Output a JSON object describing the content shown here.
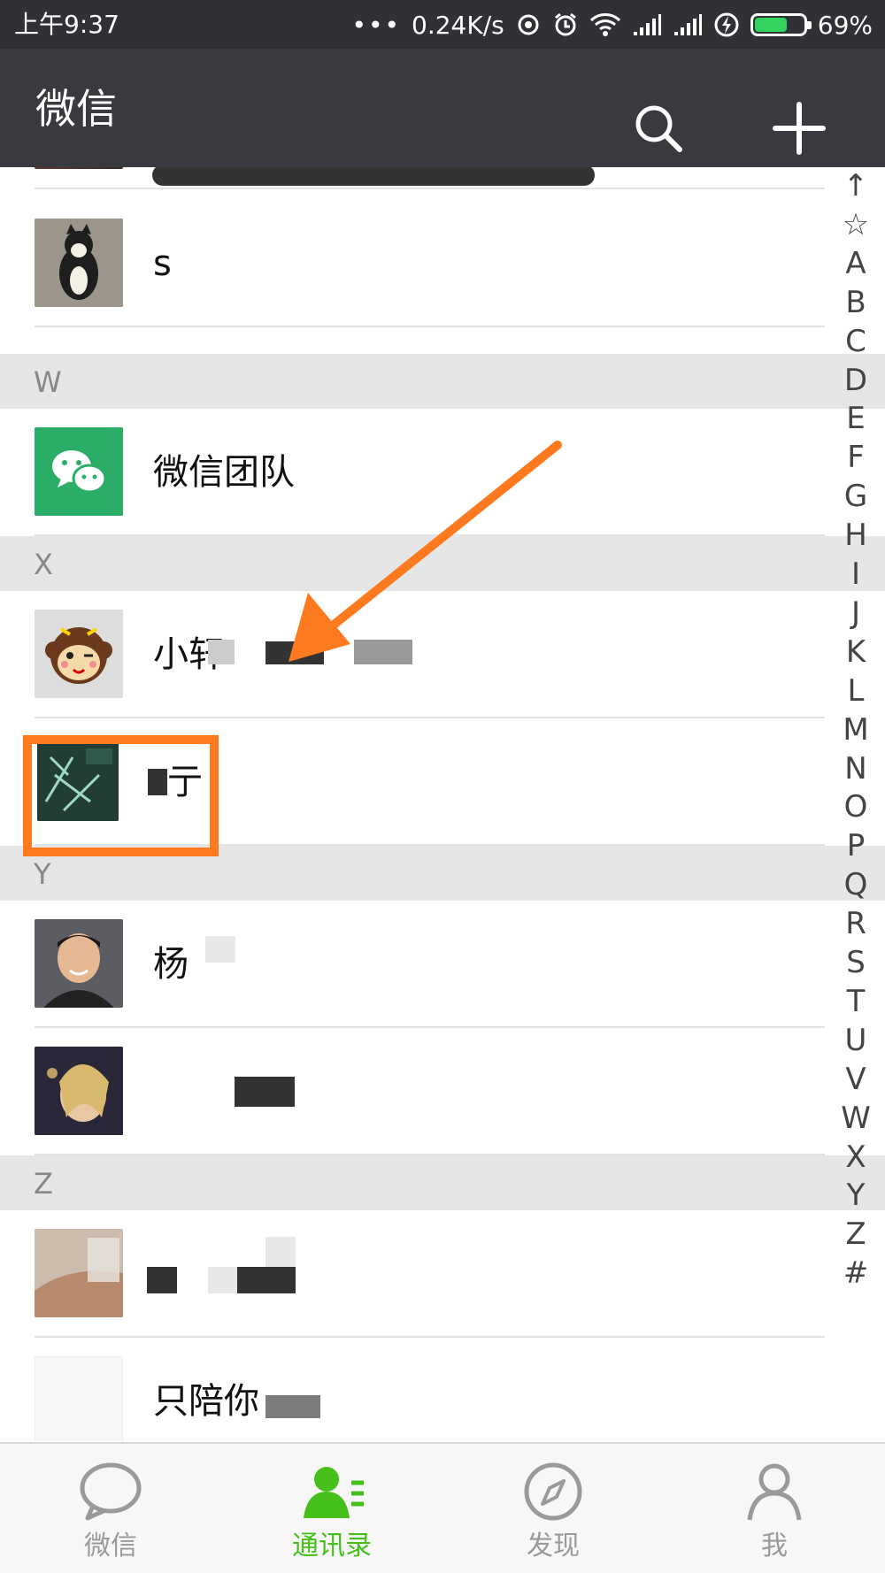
{
  "status_bar": {
    "time": "上午9:37",
    "network_speed": "0.24K/s",
    "battery": "69%",
    "battery_level": 0.69,
    "icons": [
      "more-dots-icon",
      "sync-icon",
      "alarm-icon",
      "wifi-icon",
      "signal-icon",
      "signal-icon",
      "charging-icon",
      "battery-icon"
    ]
  },
  "header": {
    "title": "微信",
    "search_icon": "search-icon",
    "add_icon": "plus-icon"
  },
  "contacts": {
    "rows": [
      {
        "name": "s"
      },
      {
        "section": "W"
      },
      {
        "name": "微信团队"
      },
      {
        "section": "X"
      },
      {
        "name": "小轩"
      },
      {
        "name": "亍"
      },
      {
        "section": "Y"
      },
      {
        "name": "杨"
      },
      {
        "name": ""
      },
      {
        "section": "Z"
      },
      {
        "name": ""
      },
      {
        "name": "只陪你"
      }
    ]
  },
  "index_bar": [
    "↑",
    "☆",
    "A",
    "B",
    "C",
    "D",
    "E",
    "F",
    "G",
    "H",
    "I",
    "J",
    "K",
    "L",
    "M",
    "N",
    "O",
    "P",
    "Q",
    "R",
    "S",
    "T",
    "U",
    "V",
    "W",
    "X",
    "Y",
    "Z",
    "#"
  ],
  "tabs": [
    {
      "label": "微信",
      "icon": "chat-bubble-icon",
      "active": false
    },
    {
      "label": "通讯录",
      "icon": "contacts-icon",
      "active": true
    },
    {
      "label": "发现",
      "icon": "compass-icon",
      "active": false
    },
    {
      "label": "我",
      "icon": "person-icon",
      "active": false
    }
  ],
  "colors": {
    "header_bg": "#393a3f",
    "status_bg": "#2f3134",
    "accent_green": "#45c01a",
    "annotation_orange": "#ff7a1f",
    "section_bg": "#e6e6e6"
  }
}
